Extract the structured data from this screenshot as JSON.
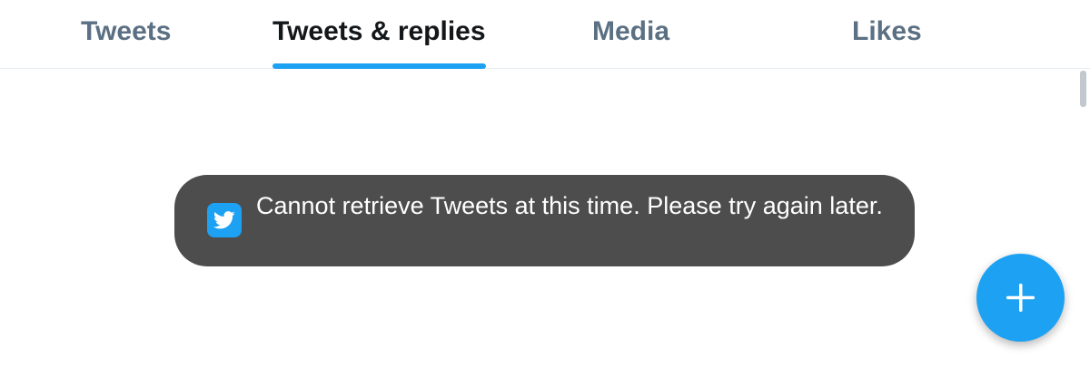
{
  "tabs": [
    {
      "label": "Tweets",
      "active": false
    },
    {
      "label": "Tweets & replies",
      "active": true
    },
    {
      "label": "Media",
      "active": false
    },
    {
      "label": "Likes",
      "active": false
    }
  ],
  "toast": {
    "icon": "twitter-bird-icon",
    "message": "Cannot retrieve Tweets at this time. Please try again later."
  },
  "fab": {
    "icon": "plus-icon"
  },
  "colors": {
    "accent": "#1da1f2",
    "active_tab_text": "#14171a",
    "inactive_tab_text": "#5b7083",
    "toast_background": "#4d4d4d",
    "toast_text": "#ffffff",
    "divider": "#e6ecf0"
  }
}
